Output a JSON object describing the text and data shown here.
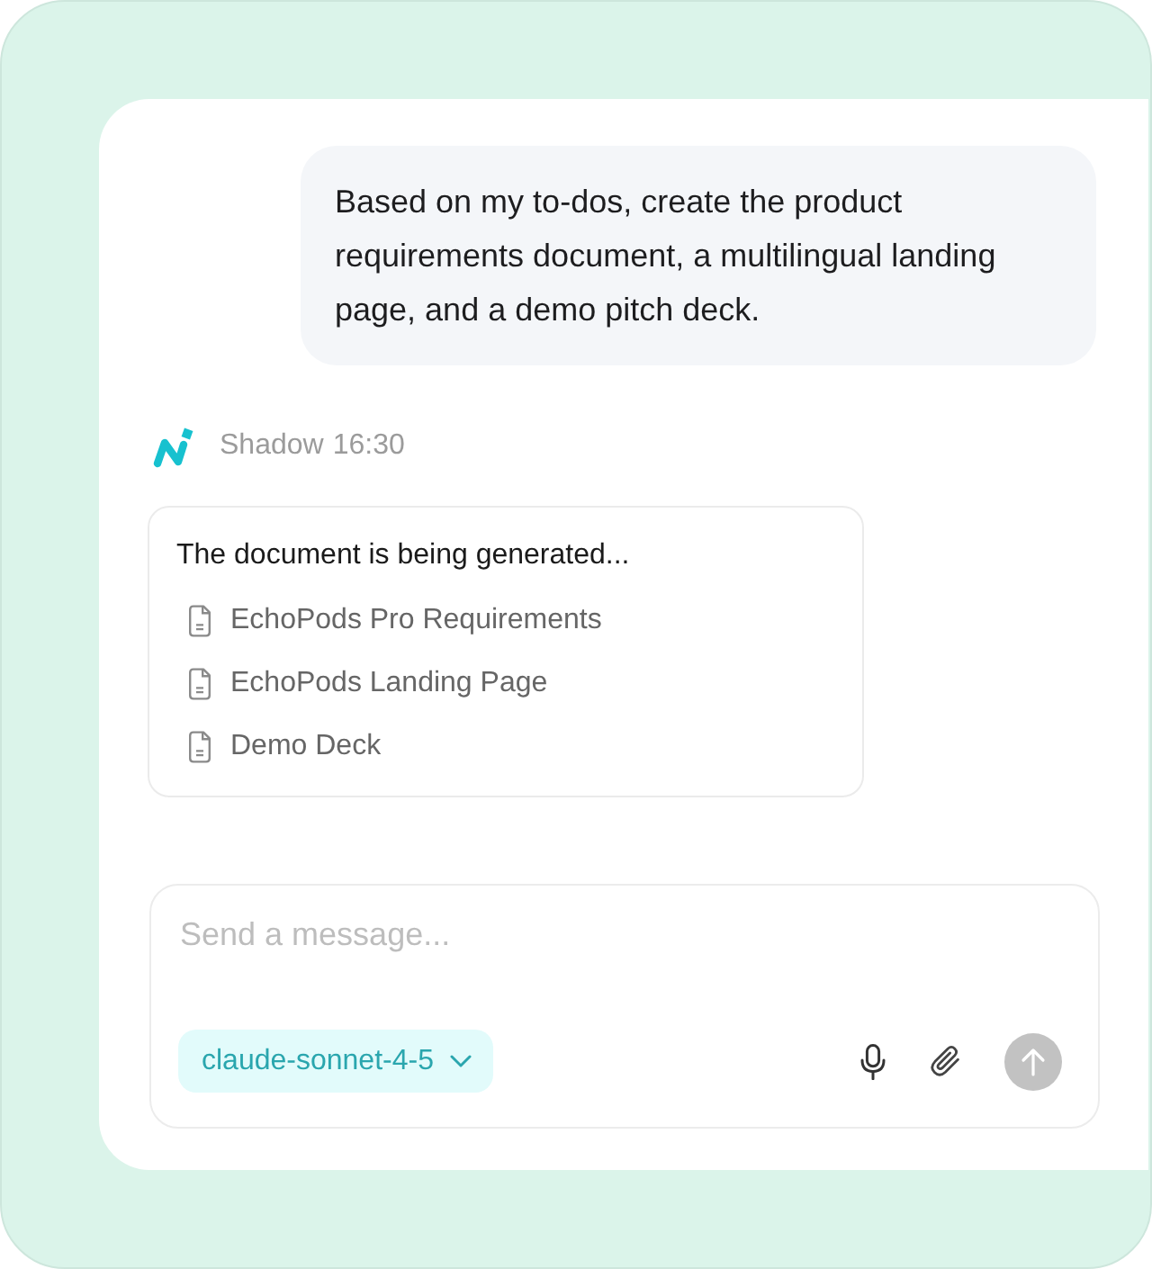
{
  "user_message": {
    "text": "Based on my to-dos, create the product requirements document, a multilingual landing page, and a demo pitch deck."
  },
  "assistant": {
    "name": "Shadow",
    "time": "16:30"
  },
  "progress_card": {
    "status": "The document is being generated...",
    "documents": [
      {
        "title": "EchoPods Pro Requirements"
      },
      {
        "title": "EchoPods Landing Page"
      },
      {
        "title": "Demo Deck"
      }
    ]
  },
  "composer": {
    "placeholder": "Send a message...",
    "model": "claude-sonnet-4-5",
    "send_disabled": true
  }
}
